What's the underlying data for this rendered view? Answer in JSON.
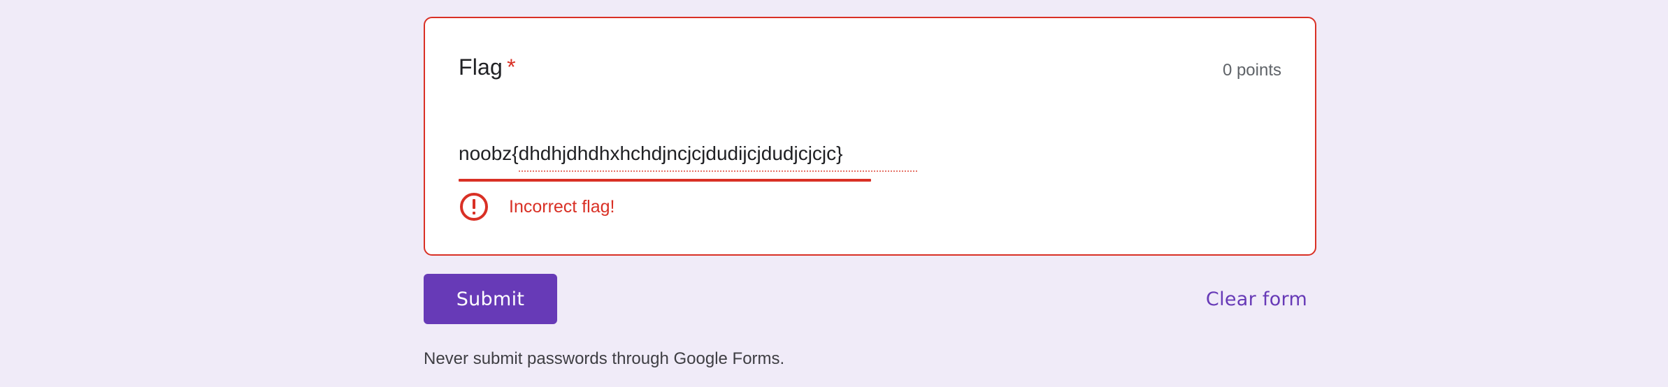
{
  "question": {
    "title": "Flag",
    "required_marker": "*",
    "points": "0 points",
    "answer_value": "noobz{dhdhjdhdhxhchdjncjcjdudijcjdudjcjcjc}",
    "error_message": "Incorrect flag!"
  },
  "actions": {
    "submit_label": "Submit",
    "clear_label": "Clear form"
  },
  "footer": {
    "note": "Never submit passwords through Google Forms."
  },
  "colors": {
    "background": "#f0ebf8",
    "error": "#d93025",
    "accent": "#673ab7"
  },
  "icons": {
    "error": "error-exclamation-circle-icon"
  }
}
